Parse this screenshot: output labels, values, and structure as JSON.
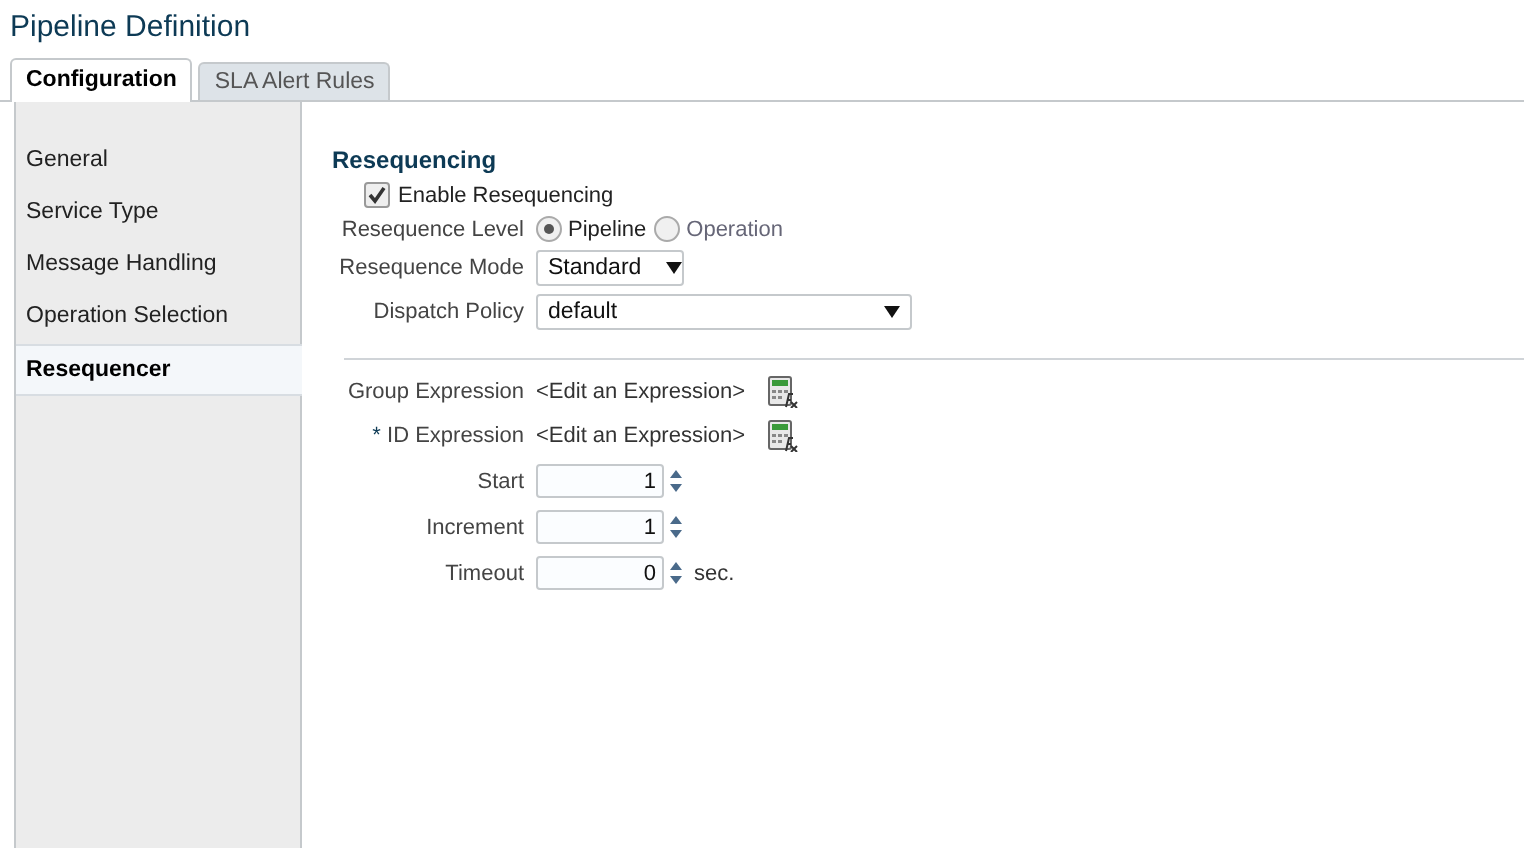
{
  "title": "Pipeline Definition",
  "tabs": [
    {
      "label": "Configuration",
      "selected": true
    },
    {
      "label": "SLA Alert Rules",
      "selected": false
    }
  ],
  "sidebar": {
    "items": [
      {
        "label": "General",
        "selected": false
      },
      {
        "label": "Service Type",
        "selected": false
      },
      {
        "label": "Message Handling",
        "selected": false
      },
      {
        "label": "Operation Selection",
        "selected": false
      },
      {
        "label": "Resequencer",
        "selected": true
      }
    ]
  },
  "section": {
    "heading": "Resequencing",
    "enable": {
      "label": "Enable Resequencing",
      "checked": true
    },
    "level": {
      "label": "Resequence Level",
      "options": [
        {
          "label": "Pipeline",
          "selected": true
        },
        {
          "label": "Operation",
          "selected": false
        }
      ]
    },
    "mode": {
      "label": "Resequence Mode",
      "value": "Standard"
    },
    "dispatch": {
      "label": "Dispatch Policy",
      "value": "default"
    },
    "expressions": [
      {
        "label": "Group Expression",
        "value": "<Edit an Expression>"
      },
      {
        "required_mark": "*",
        "label": "ID Expression",
        "value": "<Edit an Expression>"
      }
    ],
    "spinners": [
      {
        "label": "Start",
        "value": "1"
      },
      {
        "label": "Increment",
        "value": "1"
      },
      {
        "label": "Timeout",
        "value": "0",
        "unit": "sec."
      }
    ]
  }
}
